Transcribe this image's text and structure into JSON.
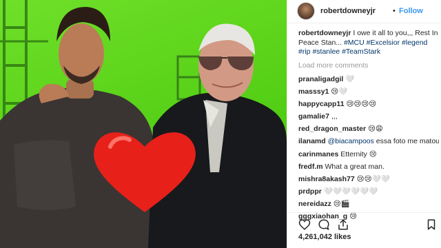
{
  "post": {
    "username": "robertdowneyjr",
    "separator": "•",
    "follow_label": "Follow",
    "caption_user": "robertdowneyjr",
    "caption_text": "I owe it all to you,,, Rest In Peace Stan...",
    "caption_tags": [
      "#MCU",
      "#Excelsior",
      "#legend",
      "#rip",
      "#stanlee",
      "#TeamStark"
    ],
    "load_more": "Load more comments",
    "likes": "4,261,042 likes"
  },
  "comments": [
    {
      "user": "pranaligadgil",
      "text": "🤍"
    },
    {
      "user": "masssy1",
      "text": "😢🤍"
    },
    {
      "user": "happycapp11",
      "text": "😢😢😢😢"
    },
    {
      "user": "gamalie7",
      "text": ",,,"
    },
    {
      "user": "red_dragon_master",
      "text": "😢😩"
    },
    {
      "user": "ilanamd",
      "mention": "@biacampoos",
      "text": " essa foto me matou"
    },
    {
      "user": "carinmanes",
      "text": "Etternity 😢"
    },
    {
      "user": "fredf.m",
      "text": "What a great man."
    },
    {
      "user": "mishra8akash77",
      "text": "😢😢🤍🤍"
    },
    {
      "user": "prdppr",
      "text": "🤍🤍🤍🤍🤍🤍"
    },
    {
      "user": "nereidazz",
      "text": "😢🎬"
    },
    {
      "user": "gggxiaohan_g",
      "text": "😢"
    }
  ],
  "icons": {
    "like": "heart-outline-icon",
    "comment": "speech-bubble-icon",
    "share": "share-arrow-icon",
    "save": "bookmark-icon"
  },
  "colors": {
    "green_screen": "#5fd51c",
    "link": "#3897f0",
    "hashtag": "#003569",
    "heart": "#e8201a"
  }
}
